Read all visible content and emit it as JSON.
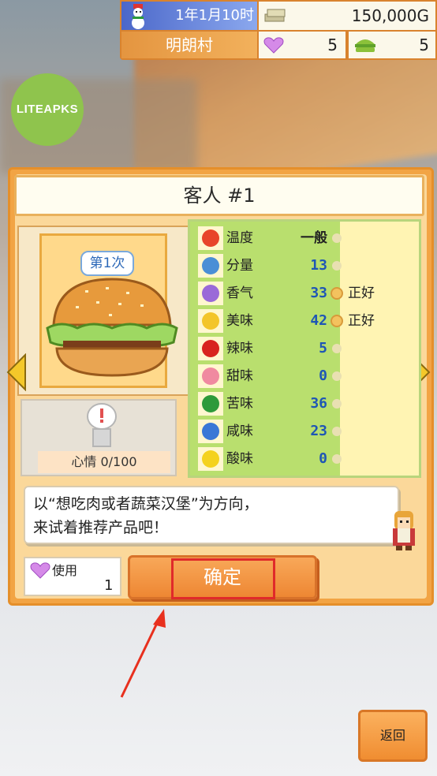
{
  "hud": {
    "date": "1年1月10时",
    "money": "150,000G",
    "village": "明朗村",
    "hearts": "5",
    "burgers": "5"
  },
  "watermark": "LITEAPKS",
  "customer": {
    "title": "客人 #1",
    "visit_badge": "第1次",
    "mood": "心情 0/100"
  },
  "stats": [
    {
      "name": "温度",
      "value": "一般",
      "eval": "",
      "icon": "fire-icon",
      "text": true
    },
    {
      "name": "分量",
      "value": "13",
      "eval": "",
      "icon": "scale-icon",
      "text": false
    },
    {
      "name": "香气",
      "value": "33",
      "eval": "正好",
      "icon": "aroma-icon",
      "text": false
    },
    {
      "name": "美味",
      "value": "42",
      "eval": "正好",
      "icon": "smile-icon",
      "text": false
    },
    {
      "name": "辣味",
      "value": "5",
      "eval": "",
      "icon": "chili-icon",
      "text": false
    },
    {
      "name": "甜味",
      "value": "0",
      "eval": "",
      "icon": "cake-icon",
      "text": false
    },
    {
      "name": "苦味",
      "value": "36",
      "eval": "",
      "icon": "melon-icon",
      "text": false
    },
    {
      "name": "咸味",
      "value": "23",
      "eval": "",
      "icon": "salt-icon",
      "text": false
    },
    {
      "name": "酸味",
      "value": "0",
      "eval": "",
      "icon": "lemon-icon",
      "text": false
    }
  ],
  "message": "以“想吃肉或者蔬菜汉堡”为方向，\n来试着推荐产品吧！",
  "use": {
    "label": "使用",
    "count": "1"
  },
  "buttons": {
    "confirm": "确定",
    "back": "返回"
  },
  "colors": {
    "accent": "#f08d31",
    "highlight": "#e02a2a",
    "stat_value": "#1e56b5"
  }
}
